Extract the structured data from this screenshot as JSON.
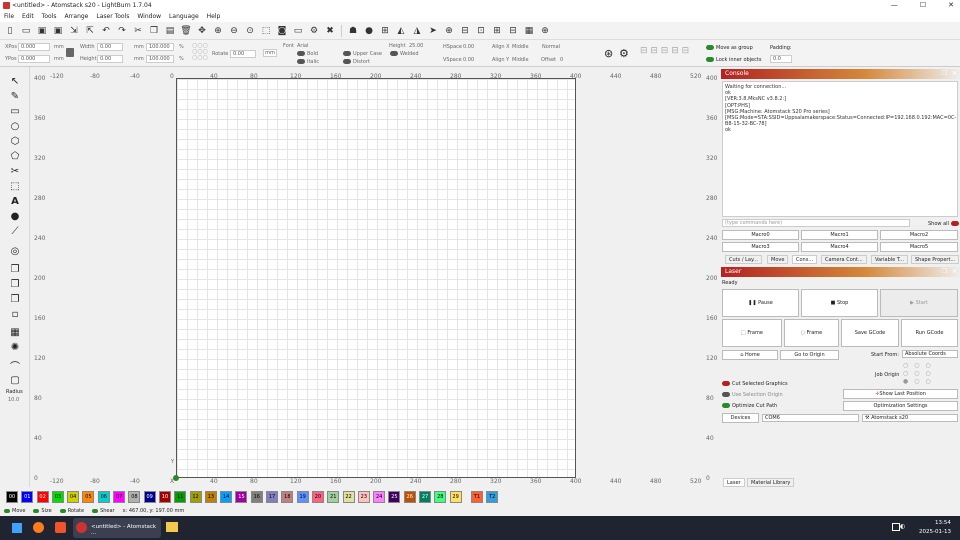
{
  "window": {
    "title": "<untitled> - Atomstack s20 - LightBurn 1.7.04",
    "min": "—",
    "max": "☐",
    "close": "✕"
  },
  "menu": [
    "File",
    "Edit",
    "Tools",
    "Arrange",
    "Laser Tools",
    "Window",
    "Language",
    "Help"
  ],
  "props": {
    "xpos_label": "XPos",
    "xpos": "0.000",
    "ypos_label": "YPos",
    "ypos": "0.000",
    "unit": "mm",
    "width_label": "Width",
    "width": "0.00",
    "height_label": "Height",
    "height": "0.00",
    "pct1": "100.000",
    "pct2": "100.000",
    "pct": "%",
    "rotate_label": "Rotate",
    "rotate": "0.00",
    "mm_btn": "mm",
    "font_label": "Font",
    "font": "Arial",
    "height2_label": "Height",
    "height2": "25.00",
    "hspace_label": "HSpace",
    "hspace": "0.00",
    "vspace_label": "VSpace",
    "vspace": "0.00",
    "alignx_label": "Align X",
    "alignx": "Middle",
    "aligny_label": "Align Y",
    "aligny": "Middle",
    "normal": "Normal",
    "offset_label": "Offset",
    "offset": "0",
    "bold": "Bold",
    "italic": "Italic",
    "upper": "Upper Case",
    "welded": "Welded",
    "distort": "Distort",
    "move_group": "Move as group",
    "lock_inner": "Lock inner objects",
    "padding_label": "Padding:",
    "padding": "0.0"
  },
  "ruler": {
    "top": [
      "-120",
      "-80",
      "-40",
      "0",
      "40",
      "80",
      "120",
      "160",
      "200",
      "240",
      "280",
      "320",
      "360",
      "400",
      "440",
      "480",
      "520"
    ],
    "left": [
      "400",
      "360",
      "320",
      "280",
      "240",
      "200",
      "160",
      "120",
      "80",
      "40",
      "0"
    ],
    "bottom": [
      "-120",
      "-80",
      "-40",
      "X",
      "40",
      "80",
      "120",
      "160",
      "200",
      "240",
      "280",
      "320",
      "360",
      "400",
      "440",
      "480",
      "520"
    ],
    "y_marker": "Y"
  },
  "lefttools": {
    "radius_label": "Radius",
    "radius": "10.0"
  },
  "palette": [
    {
      "label": "00",
      "color": "#000000",
      "fg": "#ffffff"
    },
    {
      "label": "01",
      "color": "#0000ff",
      "fg": "#ffffff"
    },
    {
      "label": "02",
      "color": "#ff0000",
      "fg": "#ffffff"
    },
    {
      "label": "03",
      "color": "#00e000",
      "fg": "#000000"
    },
    {
      "label": "04",
      "color": "#d0d000",
      "fg": "#000000"
    },
    {
      "label": "05",
      "color": "#ff8800",
      "fg": "#000000"
    },
    {
      "label": "06",
      "color": "#00d0d0",
      "fg": "#000000"
    },
    {
      "label": "07",
      "color": "#ff00ff",
      "fg": "#000000"
    },
    {
      "label": "08",
      "color": "#b0b0b0",
      "fg": "#000000"
    },
    {
      "label": "09",
      "color": "#000090",
      "fg": "#ffffff"
    },
    {
      "label": "10",
      "color": "#a00000",
      "fg": "#ffffff"
    },
    {
      "label": "11",
      "color": "#00a000",
      "fg": "#000000"
    },
    {
      "label": "12",
      "color": "#a0a000",
      "fg": "#000000"
    },
    {
      "label": "13",
      "color": "#c08000",
      "fg": "#000000"
    },
    {
      "label": "14",
      "color": "#00a0ff",
      "fg": "#000000"
    },
    {
      "label": "15",
      "color": "#a000a0",
      "fg": "#ffffff"
    },
    {
      "label": "16",
      "color": "#808080",
      "fg": "#000000"
    },
    {
      "label": "17",
      "color": "#8080c0",
      "fg": "#000000"
    },
    {
      "label": "18",
      "color": "#c08080",
      "fg": "#000000"
    },
    {
      "label": "19",
      "color": "#6090ff",
      "fg": "#000000"
    },
    {
      "label": "20",
      "color": "#ff6080",
      "fg": "#000000"
    },
    {
      "label": "21",
      "color": "#a0d0a0",
      "fg": "#000000"
    },
    {
      "label": "22",
      "color": "#e0e0a0",
      "fg": "#000000"
    },
    {
      "label": "23",
      "color": "#ffc0c0",
      "fg": "#000000"
    },
    {
      "label": "24",
      "color": "#ff80ff",
      "fg": "#000000"
    },
    {
      "label": "25",
      "color": "#400060",
      "fg": "#ffffff"
    },
    {
      "label": "26",
      "color": "#c05000",
      "fg": "#ffffff"
    },
    {
      "label": "27",
      "color": "#008060",
      "fg": "#ffffff"
    },
    {
      "label": "28",
      "color": "#40ff80",
      "fg": "#000000"
    },
    {
      "label": "29",
      "color": "#ffe060",
      "fg": "#000000"
    },
    {
      "label": "T1",
      "color": "#ff6030",
      "fg": "#000000"
    },
    {
      "label": "T2",
      "color": "#30a0e0",
      "fg": "#000000"
    }
  ],
  "status": {
    "move": "Move",
    "size": "Size",
    "rotate": "Rotate",
    "shear": "Shear",
    "coords": "x: 467.00, y: 197.00 mm"
  },
  "console": {
    "title": "Console",
    "lines": [
      "Waiting for connection...",
      "ok",
      "[VER:3.8.MksNC v3.8.2:]",
      "[OPT:PHS]",
      "[MSG:Machine: Atomstack S20 Pro series]",
      "[MSG:Mode=STA:SSID=Uppsalamakerspace:Status=Connected:IP=192.168.0.192:MAC=0C-",
      "B8-15-32-BC-78]",
      "ok"
    ],
    "placeholder": "(type commands here)",
    "show_all": "Show all",
    "macros": [
      "Macro0",
      "Macro1",
      "Macro2",
      "Macro3",
      "Macro4",
      "Macro5"
    ],
    "tabs": [
      "Cuts / Lay...",
      "Move",
      "Cons...",
      "Camera Cont...",
      "Variable T...",
      "Shape Propert..."
    ]
  },
  "laser": {
    "title": "Laser",
    "status": "Ready",
    "pause": "Pause",
    "stop": "Stop",
    "start": "Start",
    "frame1": "Frame",
    "frame2": "Frame",
    "save_gcode": "Save GCode",
    "run_gcode": "Run GCode",
    "home": "Home",
    "go_origin": "Go to Origin",
    "start_from_label": "Start From:",
    "start_from": "Absolute Coords",
    "job_origin": "Job Origin",
    "cut_selected": "Cut Selected Graphics",
    "use_selection": "Use Selection Origin",
    "show_last": "Show Last Position",
    "optimize_path": "Optimize Cut Path",
    "opt_settings": "Optimization Settings",
    "devices": "Devices",
    "port": "COM6",
    "device": "Atomstack s20",
    "bottom_tabs": [
      "Laser",
      "Material Library"
    ]
  },
  "taskbar": {
    "app": "<untitled> - Atomstack ...",
    "time": "13:54",
    "date": "2025-01-13"
  },
  "colors": {
    "accent": "#b22222",
    "toggle_on": "#2a8a2a",
    "toggle_off": "#555555"
  }
}
